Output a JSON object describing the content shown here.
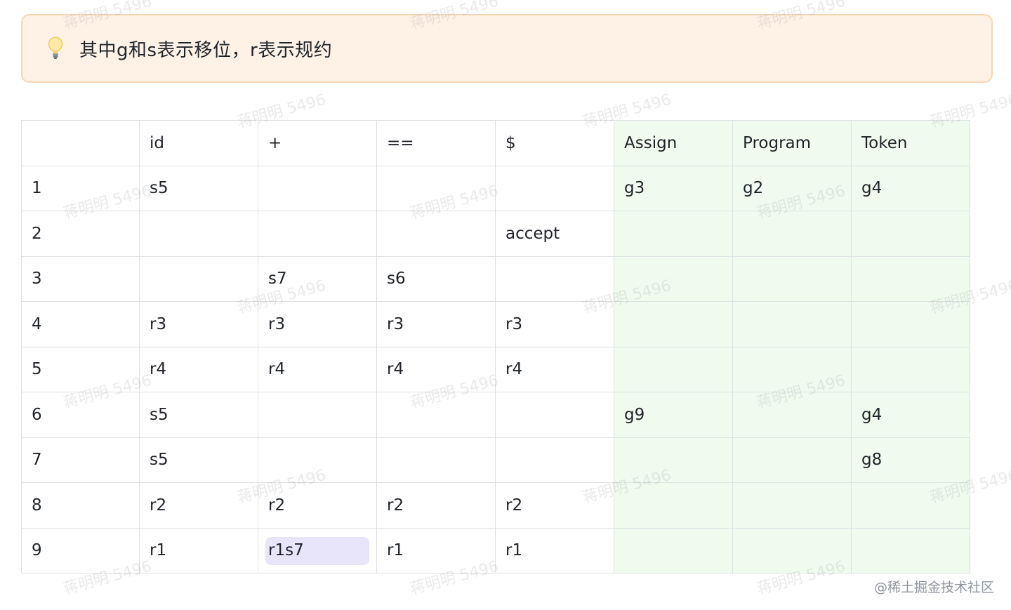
{
  "callout": {
    "icon": "lightbulb-icon",
    "text": "其中g和s表示移位，r表示规约",
    "background_color": "#fef1e6",
    "border_color": "#f8d7b6"
  },
  "table": {
    "header": [
      "",
      "id",
      "+",
      "==",
      "$",
      "Assign",
      "Program",
      "Token"
    ],
    "rows": [
      [
        "1",
        "s5",
        "",
        "",
        "",
        "g3",
        "g2",
        "g4"
      ],
      [
        "2",
        "",
        "",
        "",
        "accept",
        "",
        "",
        ""
      ],
      [
        "3",
        "",
        "s7",
        "s6",
        "",
        "",
        "",
        ""
      ],
      [
        "4",
        "r3",
        "r3",
        "r3",
        "r3",
        "",
        "",
        ""
      ],
      [
        "5",
        "r4",
        "r4",
        "r4",
        "r4",
        "",
        "",
        ""
      ],
      [
        "6",
        "s5",
        "",
        "",
        "",
        "g9",
        "",
        "g4"
      ],
      [
        "7",
        "s5",
        "",
        "",
        "",
        "",
        "",
        "g8"
      ],
      [
        "8",
        "r2",
        "r2",
        "r2",
        "r2",
        "",
        "",
        ""
      ],
      [
        "9",
        "r1",
        "r1s7",
        "r1",
        "r1",
        "",
        "",
        ""
      ]
    ],
    "goto_column_color": "#f0fbef",
    "highlight_color": "#e8e5fb",
    "highlighted_cell_value": "r1s7"
  },
  "watermark": {
    "text": "蒋明明 5496"
  },
  "site_mark": "@稀土掘金技术社区"
}
